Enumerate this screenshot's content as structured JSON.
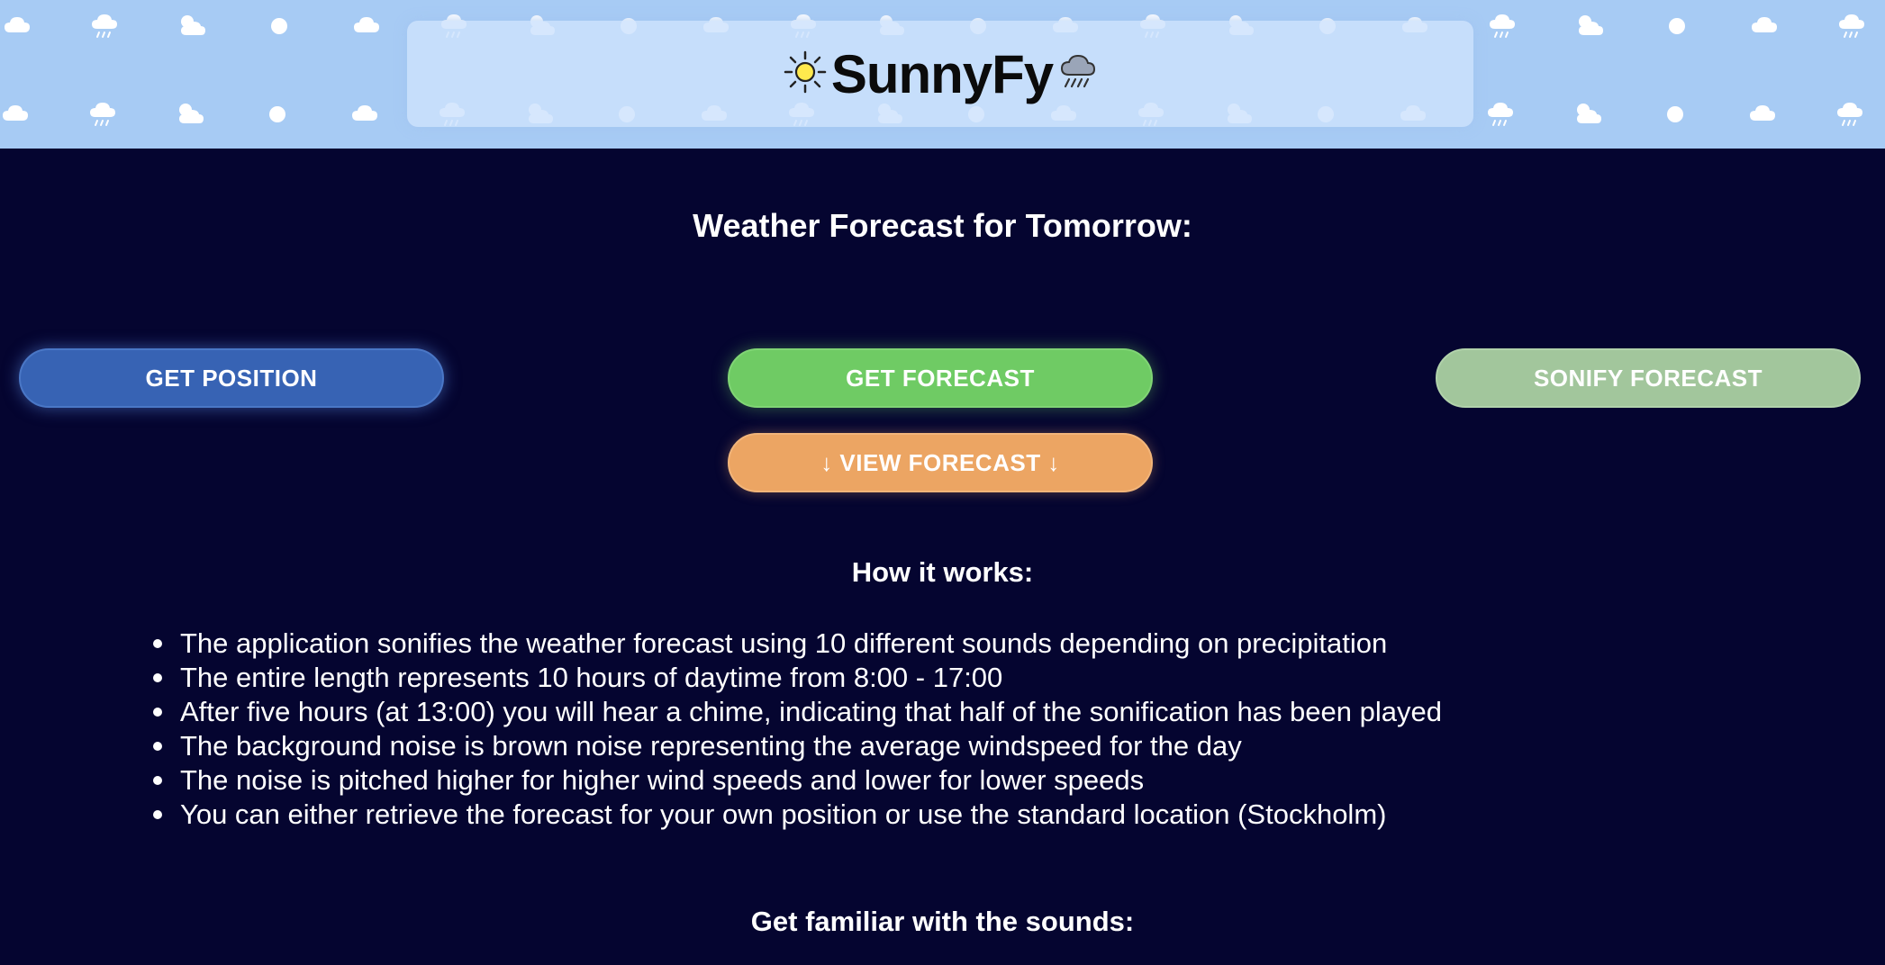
{
  "header": {
    "logo_text": "SunnyFy",
    "logo_left_icon": "sun-icon",
    "logo_right_icon": "rain-cloud-icon",
    "pattern_icons": [
      "cloud-icon",
      "rain-cloud-icon",
      "sun-cloud-icon",
      "sun-icon"
    ],
    "background_color": "#a7cbf4"
  },
  "main": {
    "title": "Weather Forecast for Tomorrow:",
    "background_color": "#050530",
    "buttons": {
      "get_position": "GET POSITION",
      "get_forecast": "GET FORECAST",
      "sonify_forecast": "SONIFY FORECAST",
      "view_forecast": "↓ VIEW FORECAST ↓"
    },
    "button_colors": {
      "get_position": "#3763b4",
      "get_forecast": "#6fcb64",
      "sonify_forecast": "#a2c69c",
      "view_forecast": "#eca563"
    }
  },
  "how_it_works": {
    "title": "How it works:",
    "items": [
      "The application sonifies the weather forecast using 10 different sounds depending on precipitation",
      "The entire length represents 10 hours of daytime from 8:00 - 17:00",
      "After five hours (at 13:00) you will hear a chime, indicating that half of the sonification has been played",
      "The background noise is brown noise representing the average windspeed for the day",
      "The noise is pitched higher for higher wind speeds and lower for lower speeds",
      "You can either retrieve the forecast for your own position or use the standard location (Stockholm)"
    ]
  },
  "sounds": {
    "title": "Get familiar with the sounds:"
  }
}
